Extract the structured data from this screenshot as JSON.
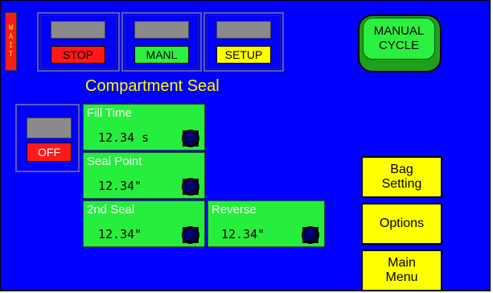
{
  "status": {
    "wait_label": "WAIT"
  },
  "modes": {
    "stop_label": "STOP",
    "manl_label": "MANL",
    "setup_label": "SETUP"
  },
  "cycle_button": {
    "line1": "MANUAL",
    "line2": "CYCLE"
  },
  "page_title": "Compartment Seal",
  "off_button_label": "OFF",
  "fields": {
    "fill_time": {
      "label": "Fill Time",
      "value": "12.34 s"
    },
    "seal_point": {
      "label": "Seal Point",
      "value": "12.34\""
    },
    "second_seal": {
      "label": "2nd Seal",
      "value": "12.34\""
    },
    "reverse": {
      "label": "Reverse",
      "value": "12.34\""
    }
  },
  "side_menu": {
    "bag_setting_line1": "Bag",
    "bag_setting_line2": "Setting",
    "options": "Options",
    "main_menu_line1": "Main",
    "main_menu_line2": "Menu"
  },
  "colors": {
    "screen_bg": "#0000fe",
    "stop_red": "#ff1a1a",
    "manl_green": "#2cf040",
    "setup_yellow": "#ffff00",
    "field_green": "#26ee3c"
  }
}
